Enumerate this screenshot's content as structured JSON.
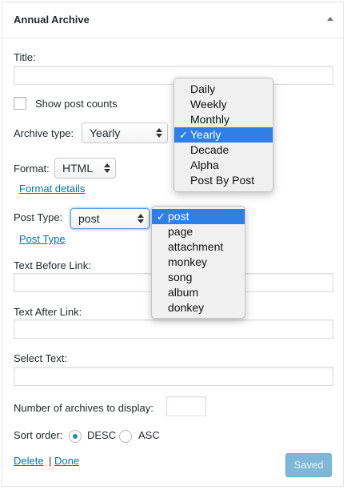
{
  "widget": {
    "title": "Annual Archive"
  },
  "form": {
    "title_label": "Title:",
    "title_value": "",
    "show_post_counts_label": "Show post counts",
    "archive_type_label": "Archive type:",
    "archive_type_value": "Yearly",
    "archive_type_options": [
      "Daily",
      "Weekly",
      "Monthly",
      "Yearly",
      "Decade",
      "Alpha",
      "Post By Post"
    ],
    "format_label": "Format:",
    "format_value": "HTML",
    "format_details_link": "Format details",
    "post_type_label": "Post Type:",
    "post_type_value": "post",
    "post_type_options": [
      "post",
      "page",
      "attachment",
      "monkey",
      "song",
      "album",
      "donkey"
    ],
    "post_type_link": "Post Type",
    "text_before_label": "Text Before Link:",
    "text_after_label": "Text After Link:",
    "select_text_label": "Select Text:",
    "num_archives_label": "Number of archives to display:",
    "sort_order_label": "Sort order:",
    "sort_desc_label": "DESC",
    "sort_asc_label": "ASC",
    "sort_selected": "DESC"
  },
  "footer": {
    "delete_link": "Delete",
    "separator": "|",
    "done_link": "Done",
    "saved_button": "Saved"
  },
  "colors": {
    "link": "#0073aa",
    "selected_highlight": "#2f7fe7",
    "saved_button_bg": "#7fb8d6"
  },
  "icons": {
    "collapse": "triangle-up-icon",
    "checkmark": "checkmark-icon",
    "select_arrows": "updown-arrows-icon"
  }
}
